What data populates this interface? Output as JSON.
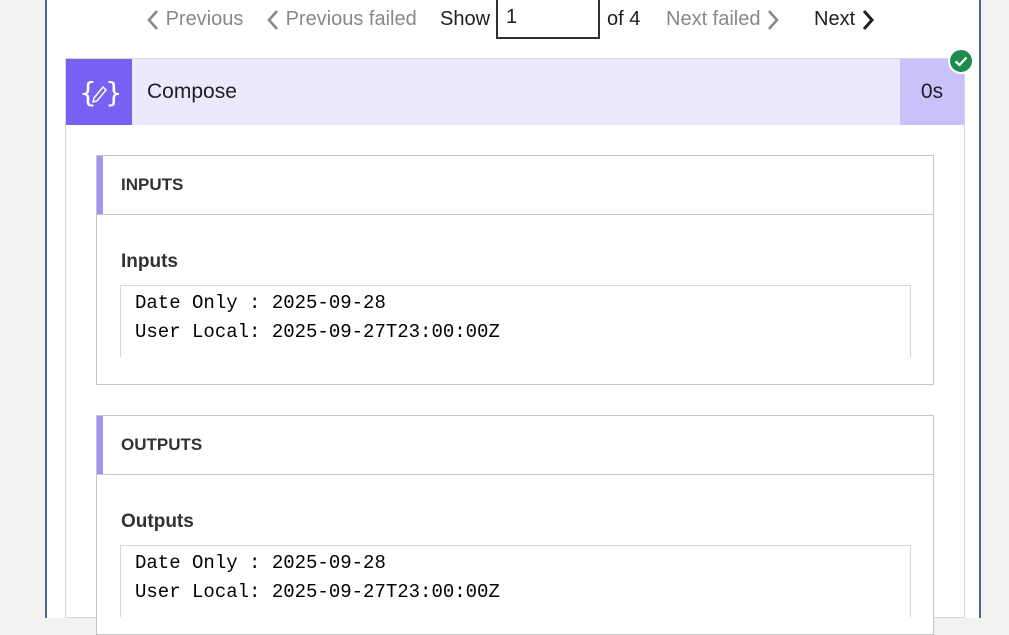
{
  "pager": {
    "previous": "Previous",
    "previous_failed": "Previous failed",
    "show": "Show",
    "current": "1",
    "of_total": "of 4",
    "next_failed": "Next failed",
    "next": "Next"
  },
  "action": {
    "title": "Compose",
    "duration": "0s",
    "icon": "compose-braces-pen-icon",
    "status": "succeeded",
    "colors": {
      "icon_bg": "#7860f2",
      "header_bg": "#ece8fd",
      "duration_bg": "#cbc1fa",
      "success": "#1e8c4e"
    }
  },
  "inputs": {
    "header": "INPUTS",
    "label": "Inputs",
    "lines": [
      "Date Only : 2025-09-28",
      "User Local: 2025-09-27T23:00:00Z"
    ]
  },
  "outputs": {
    "header": "OUTPUTS",
    "label": "Outputs",
    "lines": [
      "Date Only : 2025-09-28",
      "User Local: 2025-09-27T23:00:00Z"
    ]
  }
}
